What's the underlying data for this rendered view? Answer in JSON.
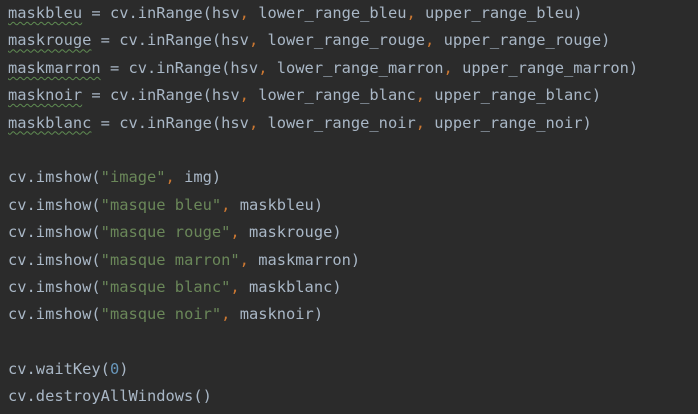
{
  "colors": {
    "background": "#2b2b2b",
    "default_text": "#a9b7c6",
    "comma": "#cc7832",
    "string": "#6a8759",
    "number": "#6897bb",
    "typo_underline": "#5f8c52"
  },
  "lines": [
    {
      "kind": "code",
      "tokens": [
        {
          "t": "maskbleu",
          "c": "tok-var",
          "sq": true
        },
        {
          "t": " = cv.inRange(hsv",
          "c": "tok-var"
        },
        {
          "t": ",",
          "c": "tok-comma"
        },
        {
          "t": " lower_range_bleu",
          "c": "tok-var"
        },
        {
          "t": ",",
          "c": "tok-comma"
        },
        {
          "t": " upper_range_bleu)",
          "c": "tok-var"
        }
      ]
    },
    {
      "kind": "code",
      "tokens": [
        {
          "t": "maskrouge",
          "c": "tok-var",
          "sq": true
        },
        {
          "t": " = cv.inRange(hsv",
          "c": "tok-var"
        },
        {
          "t": ",",
          "c": "tok-comma"
        },
        {
          "t": " lower_range_rouge",
          "c": "tok-var"
        },
        {
          "t": ",",
          "c": "tok-comma"
        },
        {
          "t": " upper_range_rouge)",
          "c": "tok-var"
        }
      ]
    },
    {
      "kind": "code",
      "tokens": [
        {
          "t": "maskmarron",
          "c": "tok-var",
          "sq": true
        },
        {
          "t": " = cv.inRange(hsv",
          "c": "tok-var"
        },
        {
          "t": ",",
          "c": "tok-comma"
        },
        {
          "t": " lower_range_marron",
          "c": "tok-var"
        },
        {
          "t": ",",
          "c": "tok-comma"
        },
        {
          "t": " upper_range_marron)",
          "c": "tok-var"
        }
      ]
    },
    {
      "kind": "code",
      "tokens": [
        {
          "t": "masknoir",
          "c": "tok-var",
          "sq": true
        },
        {
          "t": " = cv.inRange(hsv",
          "c": "tok-var"
        },
        {
          "t": ",",
          "c": "tok-comma"
        },
        {
          "t": " lower_range_blanc",
          "c": "tok-var"
        },
        {
          "t": ",",
          "c": "tok-comma"
        },
        {
          "t": " upper_range_blanc)",
          "c": "tok-var"
        }
      ]
    },
    {
      "kind": "code",
      "tokens": [
        {
          "t": "maskblanc",
          "c": "tok-var",
          "sq": true
        },
        {
          "t": " = cv.inRange(hsv",
          "c": "tok-var"
        },
        {
          "t": ",",
          "c": "tok-comma"
        },
        {
          "t": " lower_range_noir",
          "c": "tok-var"
        },
        {
          "t": ",",
          "c": "tok-comma"
        },
        {
          "t": " upper_range_noir)",
          "c": "tok-var"
        }
      ]
    },
    {
      "kind": "blank",
      "tokens": []
    },
    {
      "kind": "code",
      "tokens": [
        {
          "t": "cv.imshow(",
          "c": "tok-var"
        },
        {
          "t": "\"image\"",
          "c": "tok-str"
        },
        {
          "t": ",",
          "c": "tok-comma"
        },
        {
          "t": " img)",
          "c": "tok-var"
        }
      ]
    },
    {
      "kind": "code",
      "tokens": [
        {
          "t": "cv.imshow(",
          "c": "tok-var"
        },
        {
          "t": "\"masque bleu\"",
          "c": "tok-str"
        },
        {
          "t": ",",
          "c": "tok-comma"
        },
        {
          "t": " maskbleu)",
          "c": "tok-var"
        }
      ]
    },
    {
      "kind": "code",
      "tokens": [
        {
          "t": "cv.imshow(",
          "c": "tok-var"
        },
        {
          "t": "\"masque rouge\"",
          "c": "tok-str"
        },
        {
          "t": ",",
          "c": "tok-comma"
        },
        {
          "t": " maskrouge)",
          "c": "tok-var"
        }
      ]
    },
    {
      "kind": "code",
      "tokens": [
        {
          "t": "cv.imshow(",
          "c": "tok-var"
        },
        {
          "t": "\"masque marron\"",
          "c": "tok-str"
        },
        {
          "t": ",",
          "c": "tok-comma"
        },
        {
          "t": " maskmarron)",
          "c": "tok-var"
        }
      ]
    },
    {
      "kind": "code",
      "tokens": [
        {
          "t": "cv.imshow(",
          "c": "tok-var"
        },
        {
          "t": "\"masque blanc\"",
          "c": "tok-str"
        },
        {
          "t": ",",
          "c": "tok-comma"
        },
        {
          "t": " maskblanc)",
          "c": "tok-var"
        }
      ]
    },
    {
      "kind": "code",
      "tokens": [
        {
          "t": "cv.imshow(",
          "c": "tok-var"
        },
        {
          "t": "\"masque noir\"",
          "c": "tok-str"
        },
        {
          "t": ",",
          "c": "tok-comma"
        },
        {
          "t": " masknoir)",
          "c": "tok-var"
        }
      ]
    },
    {
      "kind": "blank",
      "tokens": []
    },
    {
      "kind": "code",
      "tokens": [
        {
          "t": "cv.waitKey(",
          "c": "tok-var"
        },
        {
          "t": "0",
          "c": "tok-num"
        },
        {
          "t": ")",
          "c": "tok-var"
        }
      ]
    },
    {
      "kind": "code",
      "tokens": [
        {
          "t": "cv.destroyAllWindows()",
          "c": "tok-var"
        }
      ]
    }
  ]
}
